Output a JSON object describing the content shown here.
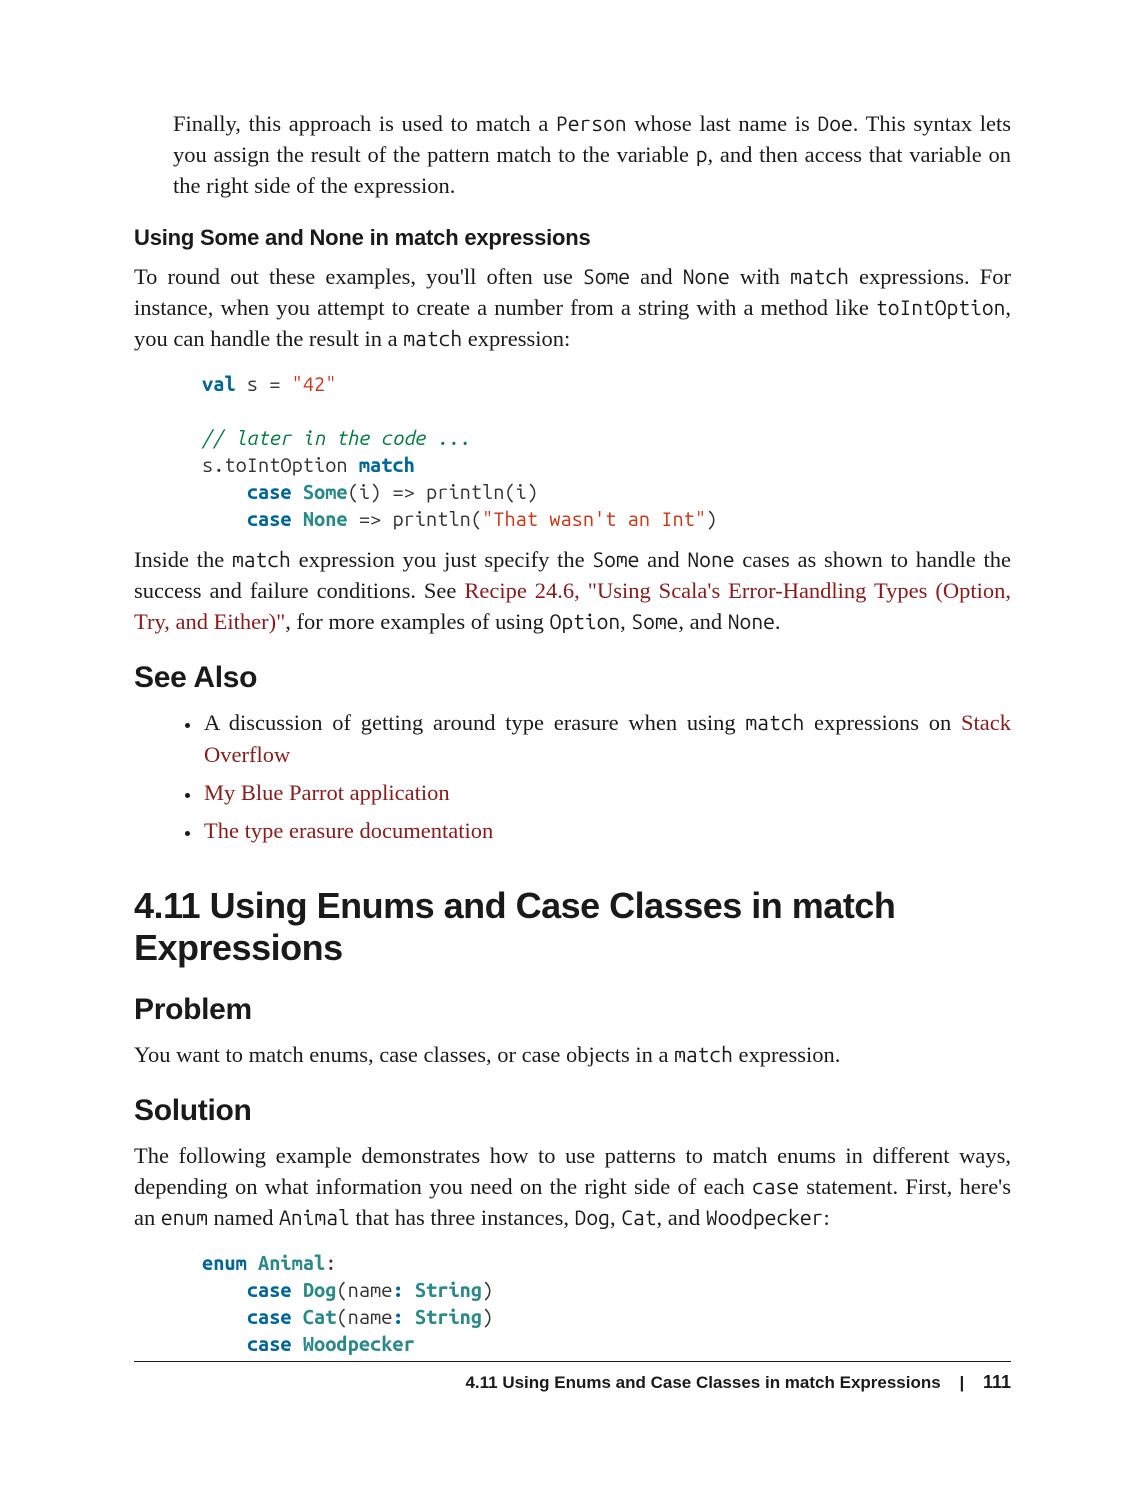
{
  "intro": {
    "part1": "Finally, this approach is used to match a ",
    "code1": "Person",
    "part2": " whose last name is ",
    "code2": "Doe",
    "part3": ". This syntax lets you assign the result of the pattern match to the variable ",
    "code3": "p",
    "part4": ", and then access that variable on the right side of the expression."
  },
  "h3_some_none": "Using Some and None in match expressions",
  "para_some_none": {
    "p1": "To round out these examples, you'll often use ",
    "c1": "Some",
    "p2": " and ",
    "c2": "None",
    "p3": " with ",
    "c3": "match",
    "p4": " expressions. For instance, when you attempt to create a number from a string with a method like ",
    "c4": "toIntOption",
    "p5": ", you can handle the result in a ",
    "c5": "match",
    "p6": " expression:"
  },
  "code1": {
    "kw_val": "val",
    "s": " s = ",
    "str42": "\"42\"",
    "comment": "// later in the code ...",
    "line3a": "s.toIntOption ",
    "kw_match": "match",
    "line4a": "    ",
    "kw_case1": "case",
    "line4b": " ",
    "cls_some": "Some",
    "line4c": "(i) => println(i)",
    "line5a": "    ",
    "kw_case2": "case",
    "line5b": " ",
    "cls_none": "None",
    "line5c": " => println(",
    "str_msg": "\"That wasn't an Int\"",
    "line5d": ")"
  },
  "para_after_code": {
    "p1": "Inside the ",
    "c1": "match",
    "p2": " expression you just specify the ",
    "c2": "Some",
    "p3": " and ",
    "c3": "None",
    "p4": " cases as shown to handle the success and failure conditions. See ",
    "link": "Recipe 24.6, \"Using Scala's Error-Handling Types (Option, Try, and Either)\"",
    "p5": ", for more examples of using ",
    "c4": "Option",
    "p6": ", ",
    "c5": "Some",
    "p7": ", and ",
    "c6": "None",
    "p8": "."
  },
  "see_also_heading": "See Also",
  "see_also": {
    "item1a": "A discussion of getting around type erasure when using ",
    "item1code": "match",
    "item1b": " expressions on ",
    "item1link": "Stack Overflow",
    "item2": "My Blue Parrot application",
    "item3": "The type erasure documentation"
  },
  "h1": "4.11 Using Enums and Case Classes in match Expressions",
  "h2_problem": "Problem",
  "problem_para": {
    "p1": "You want to match enums, case classes, or case objects in a ",
    "c1": "match",
    "p2": " expression."
  },
  "h2_solution": "Solution",
  "solution_para": {
    "p1": "The following example demonstrates how to use patterns to match enums in different ways, depending on what information you need on the right side of each ",
    "c1": "case",
    "p2": " statement. First, here's an ",
    "c2": "enum",
    "p3": " named ",
    "c3": "Animal",
    "p4": " that has three instances, ",
    "c4": "Dog",
    "p5": ", ",
    "c5": "Cat",
    "p6": ", and ",
    "c6": "Woodpecker",
    "p7": ":"
  },
  "code2": {
    "kw_enum": "enum",
    "sp": " ",
    "cls_animal": "Animal",
    "colon": ":",
    "indent": "    ",
    "kw_case1": "case",
    "cls_dog": "Dog",
    "dog_sig_a": "(name",
    "dog_sig_colon": ": ",
    "cls_string1": "String",
    "dog_sig_b": ")",
    "kw_case2": "case",
    "cls_cat": "Cat",
    "cat_sig_a": "(name",
    "cat_sig_colon": ": ",
    "cls_string2": "String",
    "cat_sig_b": ")",
    "kw_case3": "case",
    "cls_wood": "Woodpecker"
  },
  "footer": {
    "title": "4.11 Using Enums and Case Classes in match Expressions",
    "sep": "|",
    "page": "111"
  }
}
